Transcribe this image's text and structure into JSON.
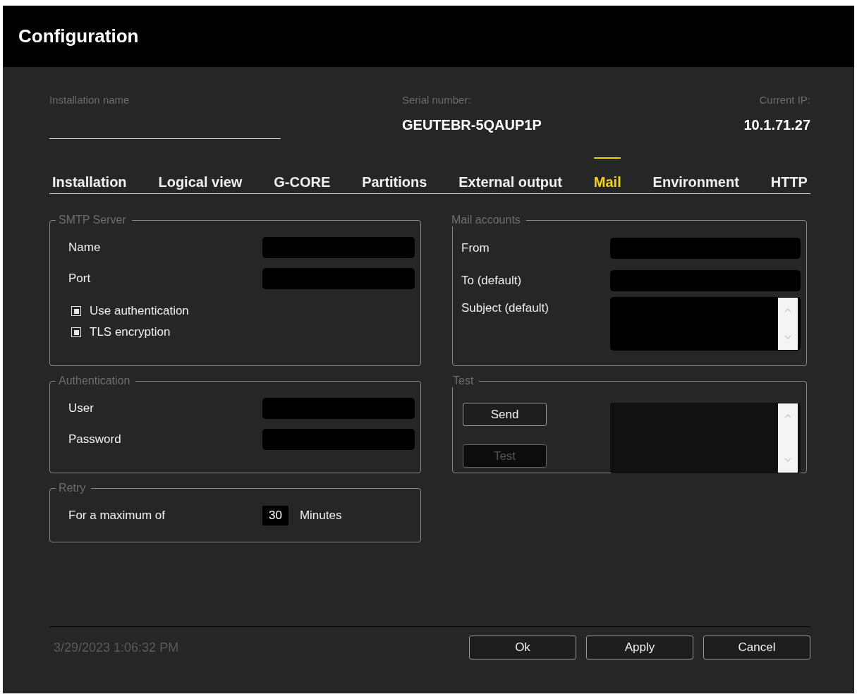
{
  "window": {
    "title": "Configuration"
  },
  "header": {
    "installation_name": {
      "label": "Installation name"
    },
    "serial_number": {
      "label": "Serial number:",
      "value": "GEUTEBR-5QAUP1P"
    },
    "current_ip": {
      "label": "Current IP:",
      "value": "10.1.71.27"
    }
  },
  "tabs": [
    {
      "label": "Installation",
      "selected": false
    },
    {
      "label": "Logical view",
      "selected": false
    },
    {
      "label": "G-CORE",
      "selected": false
    },
    {
      "label": "Partitions",
      "selected": false
    },
    {
      "label": "External output",
      "selected": false
    },
    {
      "label": "Mail",
      "selected": true
    },
    {
      "label": "Environment",
      "selected": false
    },
    {
      "label": "HTTP",
      "selected": false
    }
  ],
  "smtp_server": {
    "title": "SMTP Server",
    "fields": [
      {
        "label": "Name"
      },
      {
        "label": "Port"
      }
    ],
    "options": [
      {
        "label": "Use authentication",
        "checked": true
      },
      {
        "label": "TLS encryption",
        "checked": true
      }
    ]
  },
  "authentication": {
    "title": "Authentication",
    "fields": [
      {
        "label": "User"
      },
      {
        "label": "Password"
      }
    ]
  },
  "retry": {
    "title": "Retry",
    "label": "For a maximum of",
    "value": "30",
    "unit": "Minutes"
  },
  "mail_accounts": {
    "title": "Mail accounts",
    "fields": [
      {
        "label": "From",
        "kind": "line"
      },
      {
        "label": "To (default)",
        "kind": "line"
      },
      {
        "label": "Subject (default)",
        "kind": "multiline"
      }
    ]
  },
  "test": {
    "title": "Test",
    "buttons": [
      {
        "label": "Send",
        "disabled": false
      },
      {
        "label": "Test",
        "disabled": true
      }
    ]
  },
  "status": {
    "timestamp": "3/29/2023  1:06:32 PM"
  },
  "buttons": [
    {
      "label": "Ok"
    },
    {
      "label": "Apply"
    },
    {
      "label": "Cancel"
    }
  ]
}
